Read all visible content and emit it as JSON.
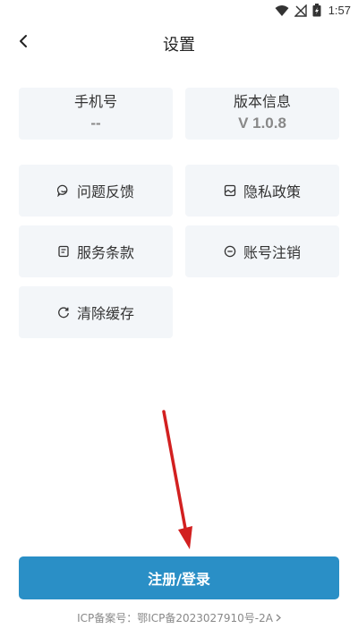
{
  "status_bar": {
    "time": "1:57"
  },
  "header": {
    "title": "设置"
  },
  "info_cards": {
    "phone": {
      "label": "手机号",
      "value": "--"
    },
    "version": {
      "label": "版本信息",
      "value": "V 1.0.8"
    }
  },
  "menu": {
    "feedback": "问题反馈",
    "privacy": "隐私政策",
    "terms": "服务条款",
    "cancel_account": "账号注销",
    "clear_cache": "清除缓存"
  },
  "actions": {
    "login_label": "注册/登录"
  },
  "footer": {
    "icp": "ICP备案号：鄂ICP备2023027910号-2A"
  },
  "colors": {
    "primary": "#2a8fc6",
    "card_bg": "#f3f6f9",
    "arrow": "#d22020"
  }
}
